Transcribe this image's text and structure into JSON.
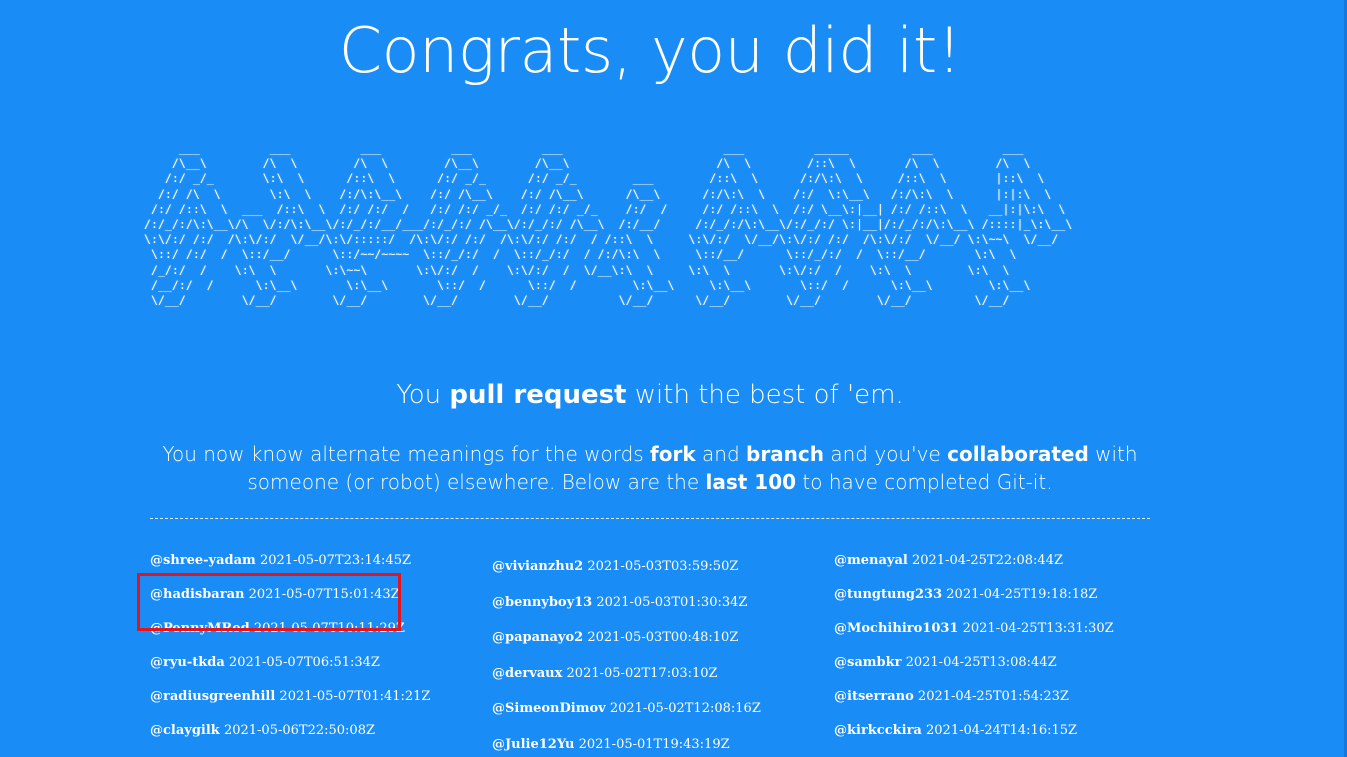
{
  "headline": "Congrats, you did it!",
  "tagline": {
    "prefix": "You ",
    "bold": "pull request",
    "suffix": " with the best of 'em."
  },
  "blurb": {
    "p1": "You now know alternate meanings for the words ",
    "fork": "fork",
    "p2": " and ",
    "branch": "branch",
    "p3": " and you've ",
    "collaborated": "collaborated",
    "p4": " with someone (or robot) elsewhere. Below are the ",
    "last100": "last 100",
    "p5": " to have completed Git-it."
  },
  "ascii_art": "      ___          ___          ___          ___          ___                       ___          _____         ___          ___     \n     /\\__\\        /\\  \\        /\\  \\        /\\__\\        /\\__\\                     /\\  \\        /::\\  \\       /\\  \\        /\\  \\    \n    /:/ _/_       \\:\\  \\      /::\\  \\      /:/ _/_      /:/ _/_        ___        /::\\  \\      /:/\\:\\  \\     /::\\  \\       |::\\  \\   \n   /:/ /\\  \\       \\:\\  \\    /:/\\:\\__\\    /:/ /\\__\\    /:/ /\\__\\      /\\__\\      /:/\\:\\  \\    /:/  \\:\\__\\   /:/\\:\\  \\      |:|:\\  \\  \n  /:/ /::\\  \\  ___  /::\\  \\  /:/ /:/  /   /:/ /:/ _/_  /:/ /:/ _/_    /:/  /     /:/ /::\\  \\  /:/ \\__\\:|__| /:/ /::\\  \\   __|:|\\:\\  \\ \n /:/_/:/\\:\\__\\/\\  \\/:/\\:\\__\\/:/_/:/__/___/:/_/:/ /\\__\\/:/_/:/ /\\__\\  /:/__/     /:/_/:/\\:\\__\\/:/_/:/ \\:|__|/:/_/:/\\:\\__\\ /::::|_\\:\\__\\\n \\:\\/:/ /:/  /\\:\\/:/  \\/__/\\:\\/:::::/  /\\:\\/:/ /:/  /\\:\\/:/ /:/  / /::\\  \\     \\:\\/:/  \\/__/\\:\\/:/ /:/  /\\:\\/:/  \\/__/ \\:\\~~\\  \\/__/\n  \\::/ /:/  /  \\::/__/      \\::/~~/~~~~  \\::/_/:/  /  \\::/_/:/  / /:/\\:\\  \\     \\::/__/      \\::/_/:/  /  \\::/__/       \\:\\  \\      \n  /_/:/  /    \\:\\  \\       \\:\\~~\\       \\:\\/:/  /    \\:\\/:/  /  \\/__\\:\\  \\     \\:\\  \\       \\:\\/:/  /    \\:\\  \\        \\:\\  \\     \n  /__/:/  /      \\:\\__\\       \\:\\__\\       \\::/  /      \\::/  /        \\:\\__\\     \\:\\__\\       \\::/  /      \\:\\__\\        \\:\\__\\    \n  \\/__/        \\/__/        \\/__/        \\/__/        \\/__/          \\/__/      \\/__/        \\/__/        \\/__/         \\/__/    ",
  "completers": {
    "col1": [
      {
        "user": "@shree-yadam",
        "time": "2021-05-07T23:14:45Z"
      },
      {
        "user": "@hadisbaran",
        "time": "2021-05-07T15:01:43Z"
      },
      {
        "user": "@PennyMRed",
        "time": "2021-05-07T10:11:29Z"
      },
      {
        "user": "@ryu-tkda",
        "time": "2021-05-07T06:51:34Z"
      },
      {
        "user": "@radiusgreenhill",
        "time": "2021-05-07T01:41:21Z"
      },
      {
        "user": "@claygilk",
        "time": "2021-05-06T22:50:08Z"
      }
    ],
    "col2": [
      {
        "user": "@vivianzhu2",
        "time": "2021-05-03T03:59:50Z"
      },
      {
        "user": "@bennyboy13",
        "time": "2021-05-03T01:30:34Z"
      },
      {
        "user": "@papanayo2",
        "time": "2021-05-03T00:48:10Z"
      },
      {
        "user": "@dervaux",
        "time": "2021-05-02T17:03:10Z"
      },
      {
        "user": "@SimeonDimov",
        "time": "2021-05-02T12:08:16Z"
      },
      {
        "user": "@Julie12Yu",
        "time": "2021-05-01T19:43:19Z"
      }
    ],
    "col3": [
      {
        "user": "@menayal",
        "time": "2021-04-25T22:08:44Z"
      },
      {
        "user": "@tungtung233",
        "time": "2021-04-25T19:18:18Z"
      },
      {
        "user": "@Mochihiro1031",
        "time": "2021-04-25T13:31:30Z"
      },
      {
        "user": "@sambkr",
        "time": "2021-04-25T13:08:44Z"
      },
      {
        "user": "@itserrano",
        "time": "2021-04-25T01:54:23Z"
      },
      {
        "user": "@kirkcckira",
        "time": "2021-04-24T14:16:15Z"
      }
    ]
  },
  "colors": {
    "background": "#1a8cf5",
    "text": "#ffffff",
    "highlight": "#e5131c"
  }
}
